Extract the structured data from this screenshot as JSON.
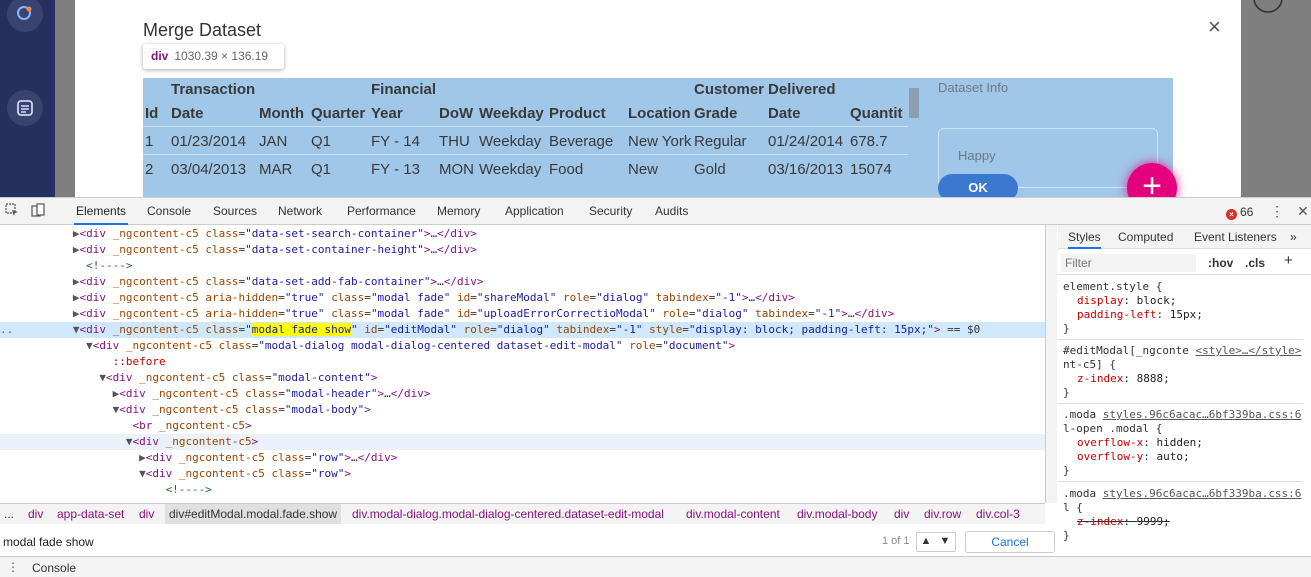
{
  "app": {
    "modal_title": "Merge Dataset",
    "close_glyph": "×",
    "tooltip": {
      "tag": "div",
      "dims": "1030.39 × 136.19"
    },
    "table": {
      "headers": [
        [
          "",
          "Id"
        ],
        [
          "Transaction",
          "Date"
        ],
        [
          "",
          "Month"
        ],
        [
          "",
          "Quarter"
        ],
        [
          "Financial",
          "Year"
        ],
        [
          "",
          "DoW"
        ],
        [
          "",
          "Weekday"
        ],
        [
          "",
          "Product"
        ],
        [
          "",
          "Location"
        ],
        [
          "Customer",
          "Grade"
        ],
        [
          "Delivered",
          "Date"
        ],
        [
          "",
          "Quantit"
        ]
      ],
      "rows": [
        [
          "1",
          "01/23/2014",
          "JAN",
          "Q1",
          "FY - 14",
          "THU",
          "Weekday",
          "Beverage",
          "New York",
          "Regular",
          "01/24/2014",
          "678.7"
        ],
        [
          "2",
          "03/04/2013",
          "MAR",
          "Q1",
          "FY - 13",
          "MON",
          "Weekday",
          "Food",
          "New",
          "Gold",
          "03/16/2013",
          "15074"
        ]
      ]
    },
    "dataset_info_title": "Dataset Info",
    "happy_label": "Happy",
    "ok_label": "OK",
    "fab_glyph": "+"
  },
  "devtools": {
    "tabs": [
      "Elements",
      "Console",
      "Sources",
      "Network",
      "Performance",
      "Memory",
      "Application",
      "Security",
      "Audits"
    ],
    "active_tab": "Elements",
    "error_count": "66",
    "styles_tabs": [
      "Styles",
      "Computed",
      "Event Listeners"
    ],
    "filter_placeholder": "Filter",
    "hov_label": ":hov",
    "cls_label": ".cls",
    "breadcrumbs": [
      "...",
      "div",
      "app-data-set",
      "div",
      "div#editModal.modal.fade.show",
      "div.modal-dialog.modal-dialog-centered.dataset-edit-modal",
      "div.modal-content",
      "div.modal-body",
      "div",
      "div.row",
      "div.col-3"
    ],
    "search_value": "modal fade show",
    "match_count": "1 of 1",
    "cancel_label": "Cancel",
    "drawer_label": "Console"
  }
}
